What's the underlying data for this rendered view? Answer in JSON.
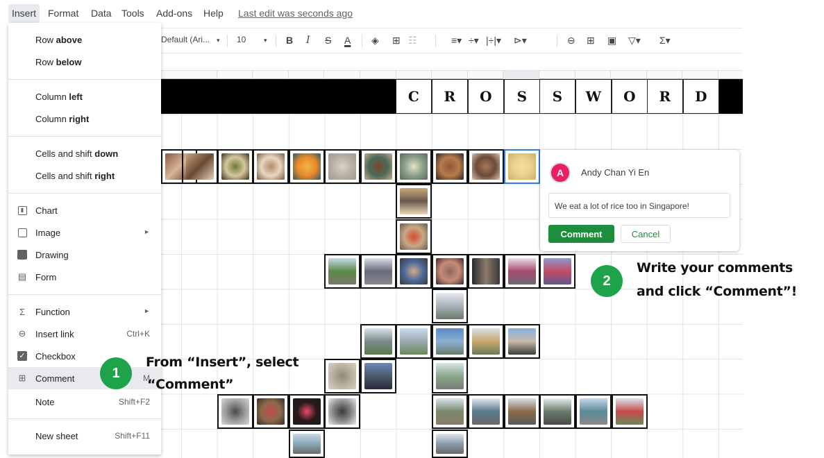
{
  "menubar": {
    "items": [
      "Insert",
      "Format",
      "Data",
      "Tools",
      "Add-ons",
      "Help"
    ],
    "last_edit": "Last edit was seconds ago"
  },
  "toolbar": {
    "font": "Default (Ari...",
    "font_size": "10",
    "bold": "B",
    "italic": "I",
    "strike": "S",
    "text_color": "A"
  },
  "insert_menu": {
    "row_above": {
      "pre": "Row ",
      "bold": "above"
    },
    "row_below": {
      "pre": "Row ",
      "bold": "below"
    },
    "column_left": {
      "pre": "Column ",
      "bold": "left"
    },
    "column_right": {
      "pre": "Column ",
      "bold": "right"
    },
    "cells_down": {
      "pre": "Cells and shift ",
      "bold": "down"
    },
    "cells_right": {
      "pre": "Cells and shift ",
      "bold": "right"
    },
    "chart": "Chart",
    "image": "Image",
    "drawing": "Drawing",
    "form": "Form",
    "function": "Function",
    "insert_link": "Insert link",
    "insert_link_shortcut": "Ctrl+K",
    "checkbox": "Checkbox",
    "comment": "Comment",
    "comment_shortcut": "M",
    "note": "Note",
    "note_shortcut": "Shift+F2",
    "new_sheet": "New sheet",
    "new_sheet_shortcut": "Shift+F11"
  },
  "crossword_letters": [
    "C",
    "R",
    "O",
    "S",
    "S",
    "W",
    "O",
    "R",
    "D"
  ],
  "comment_box": {
    "avatar_initial": "A",
    "author": "Andy Chan Yi En",
    "text": "We eat a lot of rice too in Singapore!",
    "submit": "Comment",
    "cancel": "Cancel"
  },
  "annotations": {
    "step1_number": "1",
    "step1_line1": "From “Insert”, select",
    "step1_line2": "“Comment”",
    "step2_number": "2",
    "step2_line1": "Write your comments",
    "step2_line2": "and click “Comment”!"
  },
  "colors": {
    "accent_green": "#1e8e3e",
    "badge_green": "#1fa34a",
    "avatar_pink": "#e91e63",
    "menu_highlight": "#e8eaed"
  }
}
